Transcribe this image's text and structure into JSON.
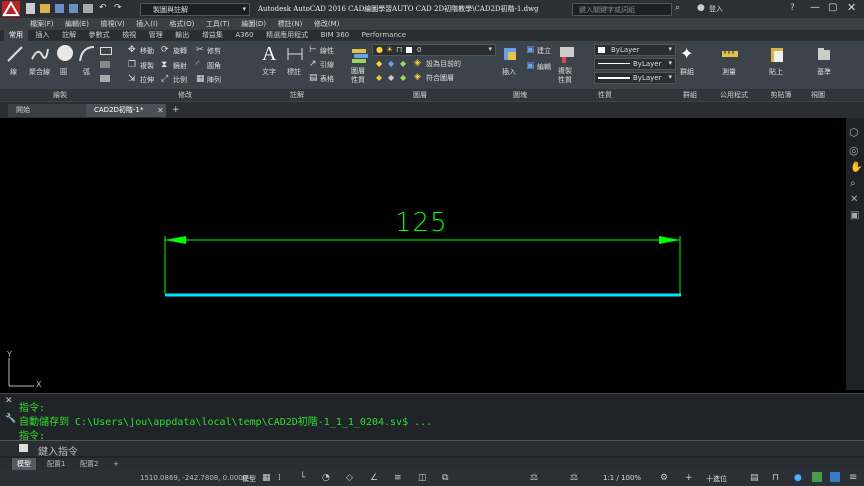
{
  "window": {
    "title": "Autodesk AutoCAD 2016   CAD繪圖學習AUTO CAD 2D初階教學\\CAD2D初階-1.dwg",
    "workspace": "製圖與註解",
    "search_placeholder": "鍵入關鍵字或詞組",
    "login": "登入"
  },
  "menu": [
    "檔案(F)",
    "編輯(E)",
    "檢視(V)",
    "插入(I)",
    "格式(O)",
    "工具(T)",
    "繪圖(D)",
    "標註(N)",
    "修改(M)"
  ],
  "ribbon_tabs": [
    "常用",
    "插入",
    "註解",
    "參數式",
    "檢視",
    "管理",
    "輸出",
    "增益集",
    "A360",
    "精選應用程式",
    "BIM 360",
    "Performance"
  ],
  "ribbon": {
    "draw": {
      "line": "線",
      "polyline": "聚合線",
      "circle": "圓",
      "arc": "弧"
    },
    "modify": {
      "move": "移動",
      "rotate": "旋轉",
      "trim": "修剪",
      "copy": "複製",
      "mirror": "鏡射",
      "fillet": "圓角",
      "stretch": "拉伸",
      "scale": "比例",
      "array": "陣列"
    },
    "annotation": {
      "text": "文字",
      "dimension": "標註",
      "leader": "引線",
      "table": "表格",
      "linear": "線性"
    },
    "layers": {
      "layer_props": "圖層性質",
      "layer_current": "設為目前的",
      "match_layer": "符合圖層",
      "layer_name": "0"
    },
    "block": {
      "insert": "插入",
      "create": "建立",
      "edit": "編輯"
    },
    "properties": {
      "match": "複製性質",
      "color": "ByLayer",
      "linetype": "ByLayer",
      "lineweight": "ByLayer"
    },
    "groups": {
      "group": "群組"
    },
    "utilities": {
      "measure": "測量"
    },
    "clipboard": {
      "paste": "貼上"
    },
    "view": {
      "base": "基準"
    }
  },
  "panel_labels": [
    "繪製",
    "修改",
    "註解",
    "圖層",
    "圖塊",
    "性質",
    "群組",
    "公用程式",
    "剪貼簿",
    "視圖"
  ],
  "file_tabs": {
    "start": "開始",
    "drawing": "CAD2D初階-1*"
  },
  "drawing": {
    "dimension_text": "125",
    "line_color": "#00e5ff",
    "dim_color": "#00ff00"
  },
  "ucs": {
    "x": "X",
    "y": "Y"
  },
  "command": {
    "lines": [
      "指令:",
      "自動儲存到 C:\\Users\\jou\\appdata\\local\\temp\\CAD2D初階-1_1_1_0204.sv$ ...",
      "指令:"
    ],
    "placeholder": "鍵入指令"
  },
  "layout_tabs": [
    "模型",
    "配置1",
    "配置2"
  ],
  "status": {
    "coords": "1510.0869, -242.7808, 0.0000",
    "model": "模型",
    "scale": "1:1 / 100%",
    "units": "十進位"
  }
}
